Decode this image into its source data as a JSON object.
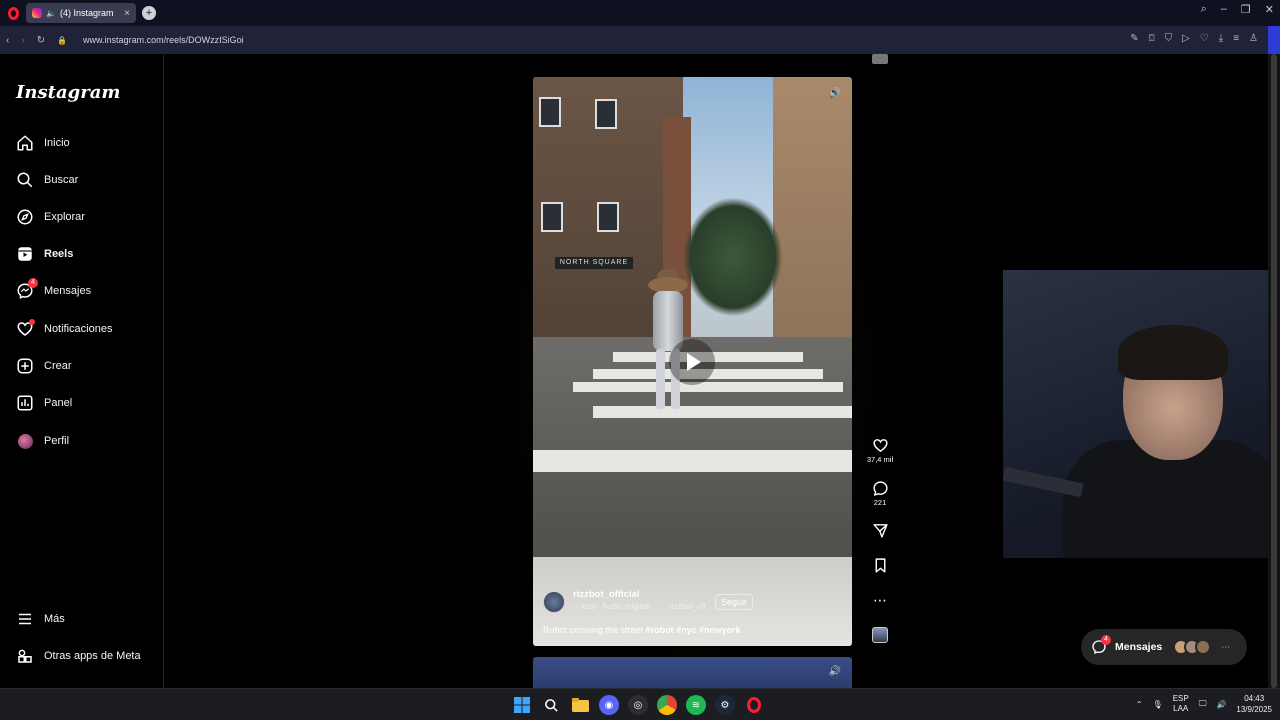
{
  "browser": {
    "tab_title": "(4) Instagram",
    "url": "www.instagram.com/reels/DOWzzISiGoi"
  },
  "sidebar": {
    "logo": "Instagram",
    "items": [
      {
        "label": "Inicio",
        "icon": "home-icon"
      },
      {
        "label": "Buscar",
        "icon": "search-icon"
      },
      {
        "label": "Explorar",
        "icon": "compass-icon"
      },
      {
        "label": "Reels",
        "icon": "reels-icon",
        "active": true
      },
      {
        "label": "Mensajes",
        "icon": "messenger-icon",
        "badge": "4"
      },
      {
        "label": "Notificaciones",
        "icon": "heart-icon"
      },
      {
        "label": "Crear",
        "icon": "plus-square-icon"
      },
      {
        "label": "Panel",
        "icon": "chart-icon"
      },
      {
        "label": "Perfil",
        "icon": "avatar"
      }
    ],
    "bottom_items": [
      {
        "label": "Más",
        "icon": "menu-icon"
      },
      {
        "label": "Otras apps de Meta",
        "icon": "apps-icon"
      }
    ]
  },
  "reel": {
    "sign_text": "NORTH SQUARE",
    "username": "rizzbot_official",
    "audio": "icial · Audio original",
    "audio_user": "rizzbot_off",
    "follow_label": "Seguir",
    "caption_text": "Robot crossing the street",
    "hashtags": "#robot #nyc #newyork"
  },
  "actions": {
    "likes": "37,4 mil",
    "comments": "221"
  },
  "messages_pill": {
    "label": "Mensajes",
    "badge": "4"
  },
  "taskbar": {
    "lang_top": "ESP",
    "lang_bottom": "LAA",
    "time": "04:43",
    "date": "13/9/2025"
  },
  "colors": {
    "notification_red": "#ff3040",
    "opera_red": "#ff1b2d",
    "sidebar_bg": "#000000"
  }
}
